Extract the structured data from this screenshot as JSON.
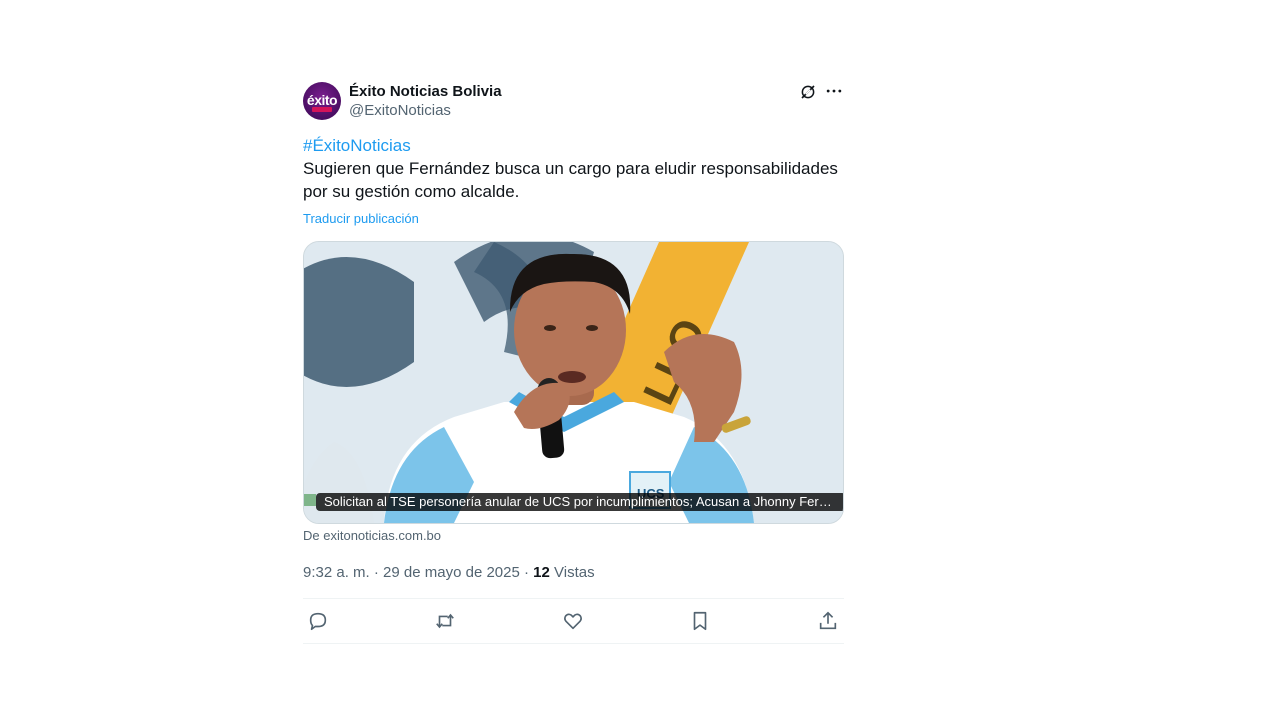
{
  "account": {
    "display_name": "Éxito Noticias Bolivia",
    "handle": "@ExitoNoticias",
    "avatar_text": "éxito"
  },
  "post": {
    "hashtag": "#ÉxitoNoticias",
    "body": "Sugieren que Fernández busca un cargo para eludir responsabilidades por su gestión como alcalde.",
    "translate_label": "Traducir publicación"
  },
  "card": {
    "caption": "Solicitan al TSE personería anular de UCS por incumplimientos; Acusan a Jhonny Fernández de buscar un cargo",
    "source": "De exitonoticias.com.bo"
  },
  "meta": {
    "time": "9:32 a. m.",
    "date": "29 de mayo de 2025",
    "views_count": "12",
    "views_label": "Vistas"
  },
  "icons": {
    "grok": "grok-icon",
    "more": "more-icon",
    "reply": "reply-icon",
    "repost": "repost-icon",
    "like": "heart-icon",
    "bookmark": "bookmark-icon",
    "share": "share-icon"
  },
  "colors": {
    "accent": "#1d9bf0",
    "secondary_text": "#536471",
    "border": "#cfd9de"
  }
}
